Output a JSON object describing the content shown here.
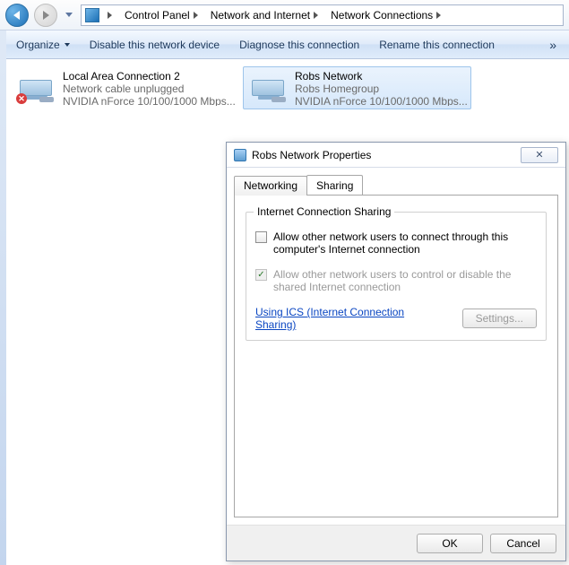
{
  "breadcrumb": {
    "items": [
      "Control Panel",
      "Network and Internet",
      "Network Connections"
    ]
  },
  "toolbar": {
    "organize": "Organize",
    "disable": "Disable this network device",
    "diagnose": "Diagnose this connection",
    "rename": "Rename this connection"
  },
  "connections": [
    {
      "title": "Local Area Connection 2",
      "status": "Network cable unplugged",
      "adapter": "NVIDIA nForce 10/100/1000 Mbps...",
      "error": true,
      "selected": false
    },
    {
      "title": "Robs Network",
      "status": "Robs Homegroup",
      "adapter": "NVIDIA nForce 10/100/1000 Mbps...",
      "error": false,
      "selected": true
    }
  ],
  "dialog": {
    "title": "Robs Network Properties",
    "tabs": {
      "networking": "Networking",
      "sharing": "Sharing"
    },
    "group_title": "Internet Connection Sharing",
    "allow_connect": "Allow other network users to connect through this computer's Internet connection",
    "allow_control": "Allow other network users to control or disable the shared Internet connection",
    "link": "Using ICS (Internet Connection Sharing)",
    "settings_btn": "Settings...",
    "ok": "OK",
    "cancel": "Cancel",
    "close_glyph": "✕"
  }
}
